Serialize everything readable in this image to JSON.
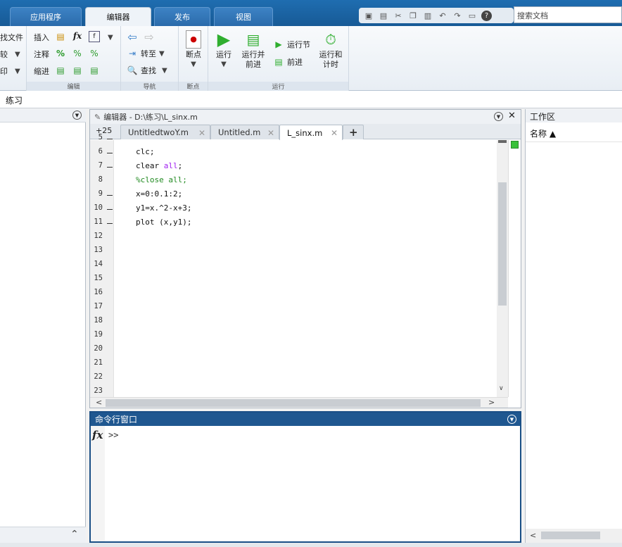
{
  "tabs": {
    "apps": "应用程序",
    "editor": "编辑器",
    "publish": "发布",
    "view": "视图"
  },
  "search": {
    "placeholder": "搜索文档"
  },
  "ribbon": {
    "file_group": {
      "find_files": "找文件",
      "compare": "较",
      "print": "印"
    },
    "edit_group": {
      "insert": "插入",
      "comment": "注释",
      "indent": "缩进",
      "label": "编辑"
    },
    "nav_group": {
      "goto": "转至",
      "find": "查找",
      "label": "导航"
    },
    "bp_group": {
      "breakpoints": "断点",
      "label": "断点"
    },
    "run_group": {
      "run": "运行",
      "run_advance_1": "运行并",
      "run_advance_2": "前进",
      "run_section": "运行节",
      "advance": "前进",
      "run_time_1": "运行和",
      "run_time_2": "计时",
      "label": "运行"
    }
  },
  "address": {
    "path": "练习"
  },
  "editor": {
    "title": "编辑器 - D:\\练习\\L_sinx.m",
    "tab_counter": "+25",
    "tabs": [
      {
        "label": "UntitledtwoY.m"
      },
      {
        "label": "Untitled.m"
      },
      {
        "label": "L_sinx.m"
      }
    ],
    "lines": [
      {
        "n": "5",
        "dash": true
      },
      {
        "n": "6",
        "dash": true
      },
      {
        "n": "7",
        "dash": true
      },
      {
        "n": "8",
        "dash": false
      },
      {
        "n": "9",
        "dash": true
      },
      {
        "n": "10",
        "dash": true
      },
      {
        "n": "11",
        "dash": true
      },
      {
        "n": "12",
        "dash": false
      },
      {
        "n": "13",
        "dash": false
      },
      {
        "n": "14",
        "dash": false
      },
      {
        "n": "15",
        "dash": false
      },
      {
        "n": "16",
        "dash": false
      },
      {
        "n": "17",
        "dash": false
      },
      {
        "n": "18",
        "dash": false
      },
      {
        "n": "19",
        "dash": false
      },
      {
        "n": "20",
        "dash": false
      },
      {
        "n": "21",
        "dash": false
      },
      {
        "n": "22",
        "dash": false
      },
      {
        "n": "23",
        "dash": false
      }
    ],
    "code": {
      "l6": "clc;",
      "l7a": "clear ",
      "l7b": "all",
      "l7c": ";",
      "l8": "%close all;",
      "l9": "x=0:0.1:2;",
      "l10": "y1=x.^2-x+3;",
      "l11": "plot (x,y1);"
    }
  },
  "command": {
    "title": "命令行窗口",
    "fx": "fx",
    "prompt": ">>"
  },
  "workspace": {
    "title": "工作区",
    "col_name": "名称 ▲"
  },
  "colors": {
    "tabbar": "#1f6db0",
    "command_header": "#1f5790",
    "keyword": "#a020f0",
    "comment": "#228b22"
  }
}
